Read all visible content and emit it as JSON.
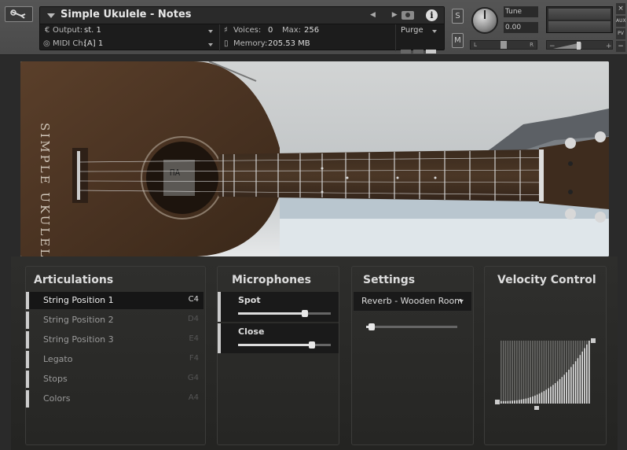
{
  "header": {
    "instrument_title": "Simple Ukulele - Notes",
    "output_label": "Output:",
    "output_value": "st. 1",
    "midi_label": "MIDI Ch:",
    "midi_value": "[A]  1",
    "voices_label": "Voices:",
    "voices_value": "0",
    "max_label": "Max:",
    "max_value": "256",
    "memory_label": "Memory:",
    "memory_value": "205.53 MB",
    "purge_label": "Purge",
    "solo_label": "S",
    "mute_label": "M",
    "tune_label": "Tune",
    "tune_value": "0.00",
    "pan_left": "L",
    "pan_right": "R",
    "aux_label": "AUX",
    "pv_label": "PV",
    "close_label": "×",
    "minus_label": "−"
  },
  "artwork": {
    "brand_text": "SIMPLE UKULELE"
  },
  "articulations": {
    "title": "Articulations",
    "items": [
      {
        "label": "String Position 1",
        "key": "C4",
        "active": true
      },
      {
        "label": "String Position 2",
        "key": "D4",
        "active": false
      },
      {
        "label": "String Position 3",
        "key": "E4",
        "active": false
      },
      {
        "label": "Legato",
        "key": "F4",
        "active": false
      },
      {
        "label": "Stops",
        "key": "G4",
        "active": false
      },
      {
        "label": "Colors",
        "key": "A4",
        "active": false
      }
    ]
  },
  "microphones": {
    "title": "Microphones",
    "items": [
      {
        "label": "Spot",
        "level": 0.72
      },
      {
        "label": "Close",
        "level": 0.8
      }
    ]
  },
  "settings": {
    "title": "Settings",
    "reverb_value": "Reverb - Wooden Room",
    "reverb_amount": 0.05
  },
  "velocity": {
    "title": "Velocity Control",
    "curve_exponent": 2.5
  }
}
